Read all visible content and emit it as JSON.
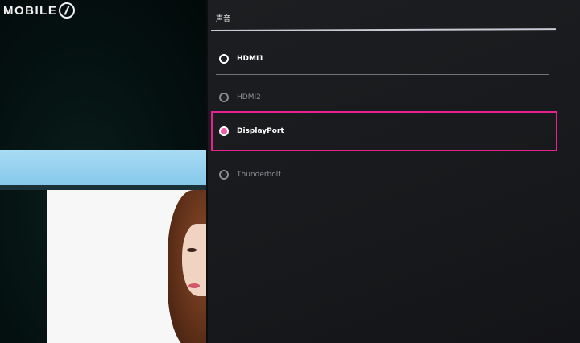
{
  "watermark": {
    "text": "MOBILE"
  },
  "osd": {
    "title": "声音",
    "options": [
      {
        "label": "HDMI1",
        "state": "active"
      },
      {
        "label": "HDMI2",
        "state": "dim"
      },
      {
        "label": "DisplayPort",
        "state": "selected"
      },
      {
        "label": "Thunderbolt",
        "state": "dim"
      }
    ],
    "accent_color": "#e5208f"
  }
}
